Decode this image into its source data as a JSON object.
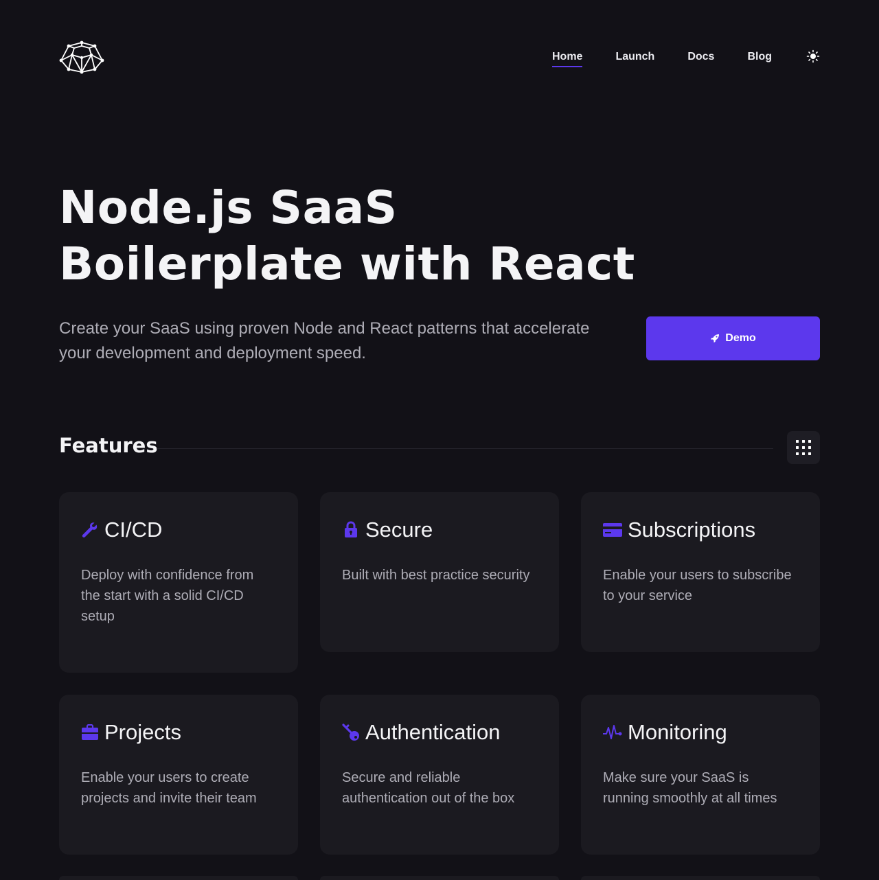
{
  "nav": {
    "items": [
      {
        "label": "Home",
        "active": true
      },
      {
        "label": "Launch",
        "active": false
      },
      {
        "label": "Docs",
        "active": false
      },
      {
        "label": "Blog",
        "active": false
      }
    ],
    "theme_icon": "sun-icon"
  },
  "hero": {
    "title_line1": "Node.js SaaS",
    "title_line2": "Boilerplate with React",
    "subtitle": "Create your SaaS using proven Node and React patterns that accelerate your development and deployment speed.",
    "demo_label": "Demo",
    "demo_icon": "rocket-icon"
  },
  "features": {
    "title": "Features",
    "view_icon": "grid-icon",
    "cards": [
      {
        "title": "CI/CD",
        "icon": "wrench-icon",
        "desc": "Deploy with confidence from the start with a solid CI/CD setup"
      },
      {
        "title": "Secure",
        "icon": "lock-icon",
        "desc": "Built with best practice security"
      },
      {
        "title": "Subscriptions",
        "icon": "credit-card-icon",
        "desc": "Enable your users to subscribe to your service"
      },
      {
        "title": "Projects",
        "icon": "briefcase-icon",
        "desc": "Enable your users to create projects and invite their team"
      },
      {
        "title": "Authentication",
        "icon": "key-icon",
        "desc": "Secure and reliable authentication out of the box"
      },
      {
        "title": "Monitoring",
        "icon": "activity-icon",
        "desc": "Make sure your SaaS is running smoothly at all times"
      }
    ]
  },
  "colors": {
    "background": "#121117",
    "card": "#1b1a20",
    "accent": "#5c38ed",
    "text": "#f4f4f6",
    "muted": "#aeadb6"
  }
}
